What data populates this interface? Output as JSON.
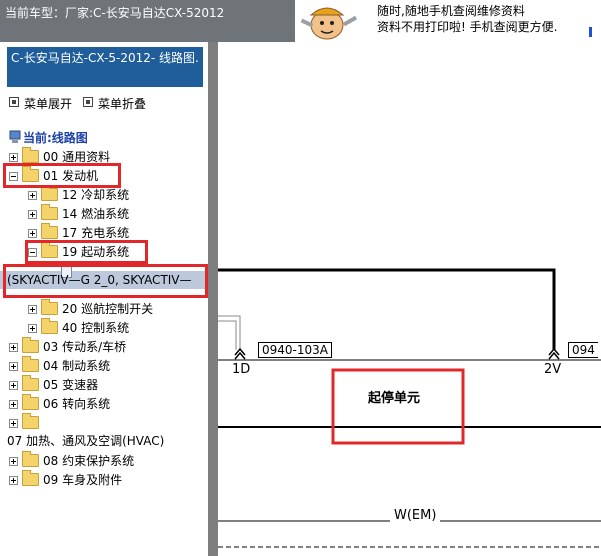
{
  "header": {
    "current_model": "当前车型：厂家:C-长安马自达CX-52012",
    "promo_line1": "随时,随地手机查阅维修资料",
    "promo_line2": "资料不用打印啦! 手机查阅更方便."
  },
  "tree": {
    "doc_title": "C-长安马自达-CX-5-2012- 线路图.",
    "expand_all": "菜单展开",
    "collapse_all": "菜单折叠",
    "current": "当前:线路图",
    "items": [
      {
        "label": "00 通用资料"
      },
      {
        "label": "01 发动机"
      },
      {
        "label": "12 冷却系统"
      },
      {
        "label": "14 燃油系统"
      },
      {
        "label": "17 充电系统"
      },
      {
        "label": "19 起动系统"
      },
      {
        "label": ""
      },
      {
        "label": "(SKYACTIV—G 2_0, SKYACTIV—"
      },
      {
        "label": "20 巡航控制开关"
      },
      {
        "label": "40 控制系统"
      },
      {
        "label": "03 传动系/车桥"
      },
      {
        "label": "04 制动系统"
      },
      {
        "label": "05 变速器"
      },
      {
        "label": "06 转向系统"
      },
      {
        "label": ""
      },
      {
        "label": "07 加热、通风及空调(HVAC)"
      },
      {
        "label": "08 约束保护系统"
      },
      {
        "label": "09 车身及附件"
      }
    ]
  },
  "diagram": {
    "connector_left": "0940-103A",
    "connector_right": "094",
    "pin_left": "1D",
    "pin_right": "2V",
    "unit_label": "起停单元",
    "wire_label": "W(EM)"
  },
  "colors": {
    "topbar": "#6f7479",
    "title_bar": "#1f5e9a",
    "selection": "#bcc8dc",
    "annotation_red": "#e0282a",
    "splitter": "#7c7e80"
  }
}
